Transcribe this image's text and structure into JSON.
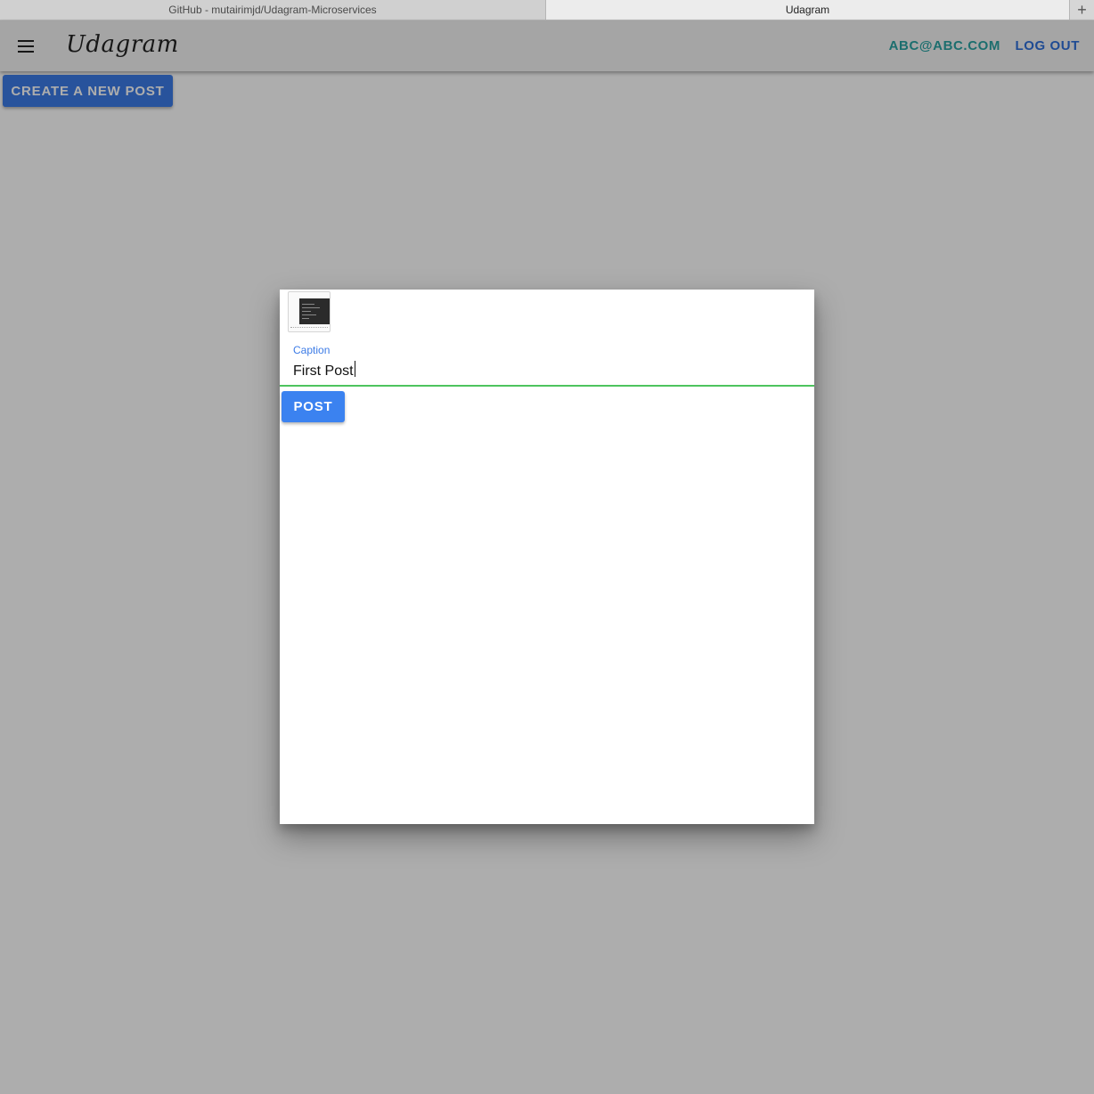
{
  "browser": {
    "tabs": [
      {
        "label": "GitHub - mutairimjd/Udagram-Microservices"
      },
      {
        "label": "Udagram"
      }
    ],
    "new_tab_icon": "+"
  },
  "app": {
    "brand": "Udagram",
    "user_email": "ABC@ABC.COM",
    "logout_label": "LOG OUT",
    "create_post_label": "CREATE A NEW POST"
  },
  "modal": {
    "caption_label": "Caption",
    "caption_value": "First Post",
    "post_label": "POST"
  },
  "colors": {
    "primary": "#3c7be6",
    "accent_teal": "#2aa3a3",
    "valid_underline": "#4ec45e"
  }
}
